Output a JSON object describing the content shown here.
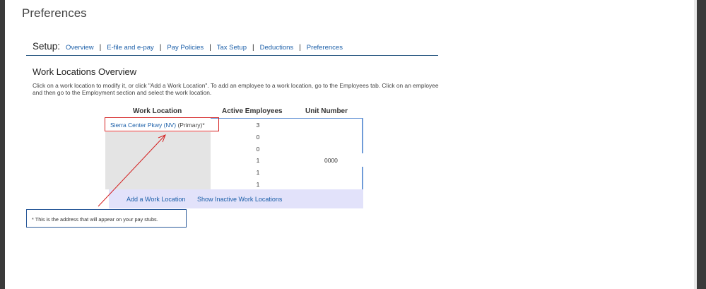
{
  "page": {
    "title": "Preferences"
  },
  "setup": {
    "label": "Setup:",
    "links": [
      "Overview",
      "E-file and e-pay",
      "Pay Policies",
      "Tax Setup",
      "Deductions",
      "Preferences"
    ],
    "separator": "|"
  },
  "section": {
    "title": "Work Locations Overview",
    "intro": "Click on a work location to modify it, or click \"Add a Work Location\". To add an employee to a work location, go to the Employees tab. Click on an employee and then go to the Employment section and select the work location."
  },
  "table": {
    "headers": {
      "location": "Work Location",
      "active": "Active Employees",
      "unit": "Unit Number"
    },
    "primary_location": {
      "name": "Sierra Center Pkwy (NV)",
      "suffix": "(Primary)*"
    },
    "active_counts": [
      "3",
      "0",
      "0",
      "1",
      "1",
      "1"
    ],
    "unit_number": "0000",
    "actions": {
      "add": "Add a Work Location",
      "inactive": "Show Inactive Work Locations"
    }
  },
  "note": "* This is the address that will appear on your pay stubs.",
  "colors": {
    "link": "#1a5ea8",
    "highlight": "#d42020",
    "footer_band": "#e2e2fa",
    "rule": "#2e5c85"
  }
}
